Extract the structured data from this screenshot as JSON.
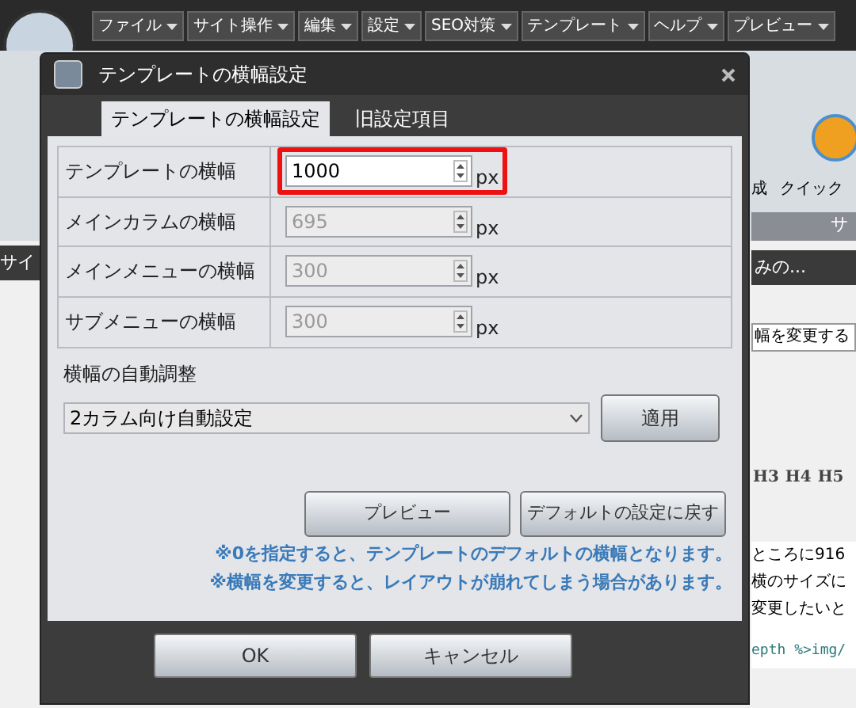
{
  "app_menu": [
    {
      "label": "ファイル"
    },
    {
      "label": "サイト操作"
    },
    {
      "label": "編集"
    },
    {
      "label": "設定"
    },
    {
      "label": "SEO対策"
    },
    {
      "label": "テンプレート"
    },
    {
      "label": "ヘルプ"
    },
    {
      "label": "プレビュー"
    }
  ],
  "background": {
    "ribbon_labels": [
      "成",
      "クイック"
    ],
    "side_label": "サ",
    "left_label": "サイ",
    "panel_title": "みの...",
    "field_text": "幅を変更する",
    "headings": [
      "H3",
      "H4",
      "H5"
    ],
    "editor_lines": [
      "ところに916",
      "横のサイズに",
      "変更したいと"
    ],
    "code_line": "epth %>img/"
  },
  "dialog": {
    "title": "テンプレートの横幅設定",
    "tabs": [
      {
        "label": "テンプレートの横幅設定",
        "selected": true
      },
      {
        "label": "旧設定項目",
        "selected": false
      }
    ],
    "fields": [
      {
        "label": "テンプレートの横幅",
        "value": "1000",
        "unit": "px",
        "disabled": false,
        "highlighted": true
      },
      {
        "label": "メインカラムの横幅",
        "value": "695",
        "unit": "px",
        "disabled": true,
        "highlighted": false
      },
      {
        "label": "メインメニューの横幅",
        "value": "300",
        "unit": "px",
        "disabled": true,
        "highlighted": false
      },
      {
        "label": "サブメニューの横幅",
        "value": "300",
        "unit": "px",
        "disabled": true,
        "highlighted": false
      }
    ],
    "auto_adjust": {
      "title": "横幅の自動調整",
      "dropdown": "2カラム向け自動設定",
      "button": "適用"
    },
    "action_buttons": [
      "プレビュー",
      "デフォルトの設定に戻す"
    ],
    "notes": [
      "※0を指定すると、テンプレートのデフォルトの横幅となります。",
      "※横幅を変更すると、レイアウトが崩れてしまう場合があります。"
    ],
    "footer_buttons": [
      "OK",
      "キャンセル"
    ]
  }
}
